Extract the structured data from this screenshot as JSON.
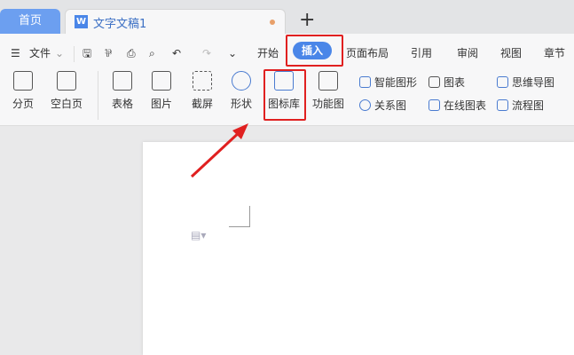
{
  "tabs": {
    "home": "首页",
    "doc": "文字文稿1",
    "doc_icon": "W",
    "new": "+"
  },
  "menu": {
    "file": "文件",
    "items": [
      "开始",
      "插入",
      "页面布局",
      "引用",
      "审阅",
      "视图",
      "章节"
    ],
    "active": "插入"
  },
  "ribbon": {
    "big": [
      "分页",
      "空白页",
      "表格",
      "图片",
      "截屏",
      "形状",
      "图标库",
      "功能图"
    ],
    "small": [
      "智能图形",
      "关系图",
      "图表",
      "在线图表",
      "思维导图",
      "流程图"
    ]
  },
  "colors": {
    "accent": "#4a86e8",
    "highlight": "#e02020"
  }
}
